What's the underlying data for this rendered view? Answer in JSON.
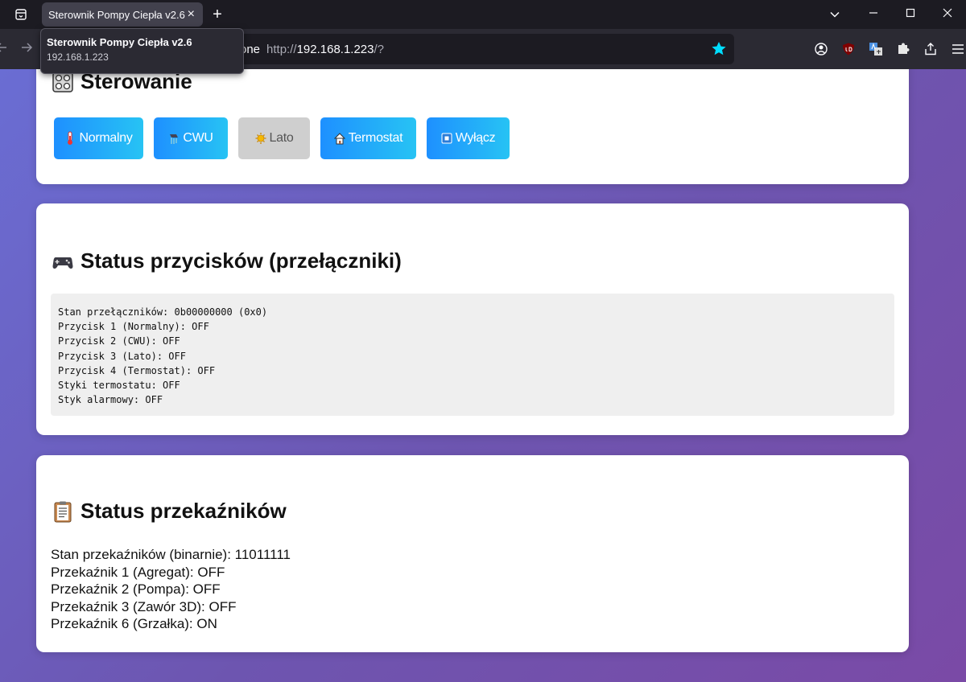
{
  "browser": {
    "tab_title": "Sterownik Pompy Ciepła v2.6",
    "tab_close": "×",
    "new_tab": "+",
    "url_partial": "one",
    "url_protocol": "http://",
    "url_host": "192.168.1.223",
    "url_path": "/?",
    "tooltip_title": "Sterownik Pompy Ciepła v2.6",
    "tooltip_url": "192.168.1.223",
    "accent_star_color": "#00ddff"
  },
  "control": {
    "title": "Sterowanie",
    "buttons": [
      {
        "label": "Normalny",
        "icon": "thermometer-icon"
      },
      {
        "label": "CWU",
        "icon": "shower-icon"
      },
      {
        "label": "Lato",
        "icon": "sun-icon"
      },
      {
        "label": "Termostat",
        "icon": "house-icon"
      },
      {
        "label": "Wyłącz",
        "icon": "stop-icon"
      }
    ]
  },
  "switches": {
    "title": "Status przycisków (przełączniki)",
    "lines": [
      "Stan przełączników: 0b00000000 (0x0)",
      "Przycisk 1 (Normalny): OFF",
      "Przycisk 2 (CWU): OFF",
      "Przycisk 3 (Lato): OFF",
      "Przycisk 4 (Termostat): OFF",
      "Styki termostatu: OFF",
      "Styk alarmowy: OFF"
    ]
  },
  "relays": {
    "title": "Status przekaźników",
    "lines": [
      "Stan przekaźników (binarnie): 11011111",
      "Przekaźnik 1 (Agregat): OFF",
      "Przekaźnik 2 (Pompa): OFF",
      "Przekaźnik 3 (Zawór 3D): OFF",
      "Przekaźnik 6 (Grzałka): ON"
    ]
  }
}
